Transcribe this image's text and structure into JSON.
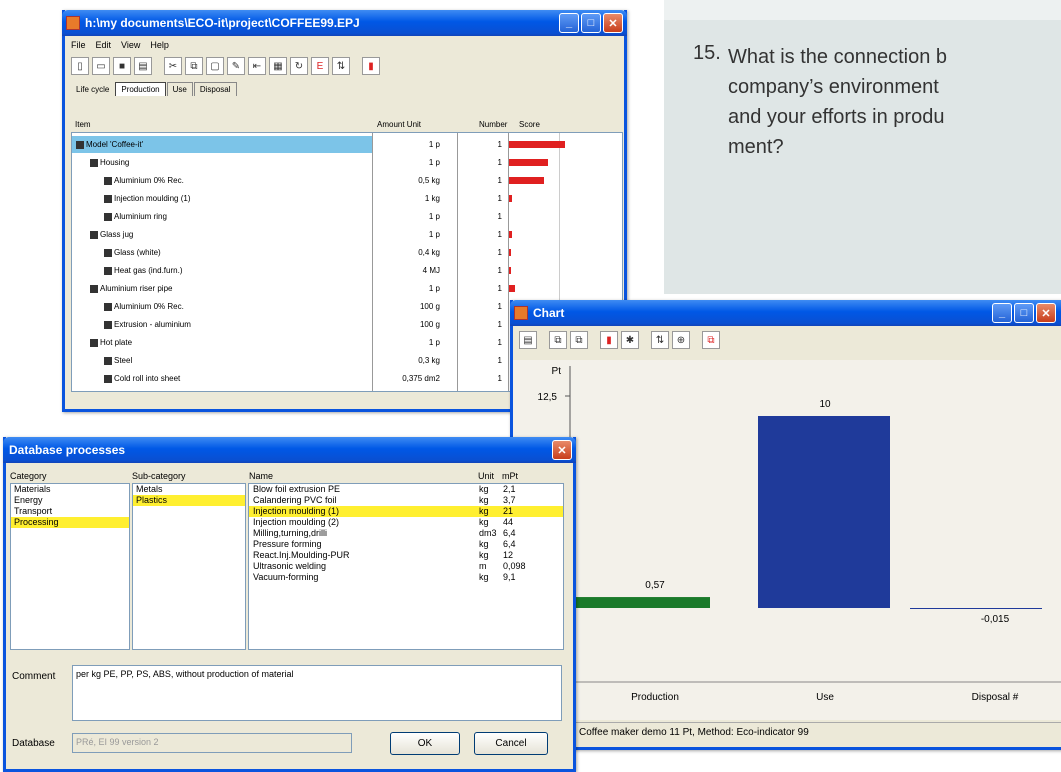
{
  "question": {
    "number": "15.",
    "text": "What is the connection b\ncompany’s environment\nand your efforts in produ\nment?"
  },
  "project_window": {
    "title": "h:\\my documents\\ECO-it\\project\\COFFEE99.EPJ",
    "menu": [
      "File",
      "Edit",
      "View",
      "Help"
    ],
    "tabs": [
      "Life cycle",
      "Production",
      "Use",
      "Disposal"
    ],
    "columns": {
      "item": "Item",
      "amount_unit": "Amount Unit",
      "number": "Number",
      "score": "Score"
    },
    "rows": [
      {
        "label": "Model 'Coffee-it'",
        "amount": "1 p",
        "number": "1",
        "score": 1.0,
        "level": 0,
        "selected": true
      },
      {
        "label": "Housing",
        "amount": "1 p",
        "number": "1",
        "score": 0.7,
        "level": 1
      },
      {
        "label": "Aluminium 0% Rec.",
        "amount": "0,5 kg",
        "number": "1",
        "score": 0.62,
        "level": 2
      },
      {
        "label": "Injection moulding (1)",
        "amount": "1 kg",
        "number": "1",
        "score": 0.06,
        "level": 2
      },
      {
        "label": "Aluminium ring",
        "amount": "1 p",
        "number": "1",
        "score": 0.0,
        "level": 2
      },
      {
        "label": "Glass jug",
        "amount": "1 p",
        "number": "1",
        "score": 0.06,
        "level": 1
      },
      {
        "label": "Glass (white)",
        "amount": "0,4 kg",
        "number": "1",
        "score": 0.04,
        "level": 2
      },
      {
        "label": "Heat gas (ind.furn.)",
        "amount": "4 MJ",
        "number": "1",
        "score": 0.04,
        "level": 2
      },
      {
        "label": "Aluminium riser pipe",
        "amount": "1 p",
        "number": "1",
        "score": 0.1,
        "level": 1
      },
      {
        "label": "Aluminium 0% Rec.",
        "amount": "100 g",
        "number": "1",
        "score": 0.0,
        "level": 2
      },
      {
        "label": "Extrusion - aluminium",
        "amount": "100 g",
        "number": "1",
        "score": 0.0,
        "level": 2
      },
      {
        "label": "Hot plate",
        "amount": "1 p",
        "number": "1",
        "score": 0.0,
        "level": 1
      },
      {
        "label": "Steel",
        "amount": "0,3 kg",
        "number": "1",
        "score": 0.0,
        "level": 2
      },
      {
        "label": "Cold roll into sheet",
        "amount": "0,375 dm2",
        "number": "1",
        "score": 0.0,
        "level": 2
      }
    ]
  },
  "chart_window": {
    "title": "Chart",
    "status": "Coffee maker demo 11 Pt,  Method: Eco-indicator 99",
    "chart_data": {
      "type": "bar",
      "categories": [
        "Production",
        "Use",
        "Disposal #"
      ],
      "values": [
        0.57,
        10,
        -0.015
      ],
      "value_labels": [
        "0,57",
        "10",
        "-0,015"
      ],
      "colors": [
        "#1a7a2a",
        "#1f3a9a",
        "#1f3a9a"
      ],
      "ylabel": "Pt",
      "ytick": "12,5"
    }
  },
  "db_window": {
    "title": "Database processes",
    "headers": {
      "category": "Category",
      "subcategory": "Sub-category",
      "name": "Name",
      "unit": "Unit",
      "mpt": "mPt"
    },
    "categories": [
      "Materials",
      "Energy",
      "Transport",
      "Processing"
    ],
    "category_selected": 3,
    "subcategories": [
      "Metals",
      "Plastics"
    ],
    "subcategory_selected": 1,
    "processes": [
      {
        "name": "Blow foil extrusion PE",
        "unit": "kg",
        "mpt": "2,1"
      },
      {
        "name": "Calandering PVC foil",
        "unit": "kg",
        "mpt": "3,7"
      },
      {
        "name": "Injection moulding (1)",
        "unit": "kg",
        "mpt": "21"
      },
      {
        "name": "Injection moulding (2)",
        "unit": "kg",
        "mpt": "44"
      },
      {
        "name": "Milling,turning,drilli",
        "unit": "dm3",
        "mpt": "6,4"
      },
      {
        "name": "Pressure forming",
        "unit": "kg",
        "mpt": "6,4"
      },
      {
        "name": "React.Inj.Moulding-PUR",
        "unit": "kg",
        "mpt": "12"
      },
      {
        "name": "Ultrasonic welding",
        "unit": "m",
        "mpt": "0,098"
      },
      {
        "name": "Vacuum-forming",
        "unit": "kg",
        "mpt": "9,1"
      }
    ],
    "process_selected": 2,
    "comment_label": "Comment",
    "comment": "per kg  PE, PP, PS, ABS, without production of material",
    "database_label": "Database",
    "database_value": "PRé, EI 99 version 2",
    "ok": "OK",
    "cancel": "Cancel"
  }
}
